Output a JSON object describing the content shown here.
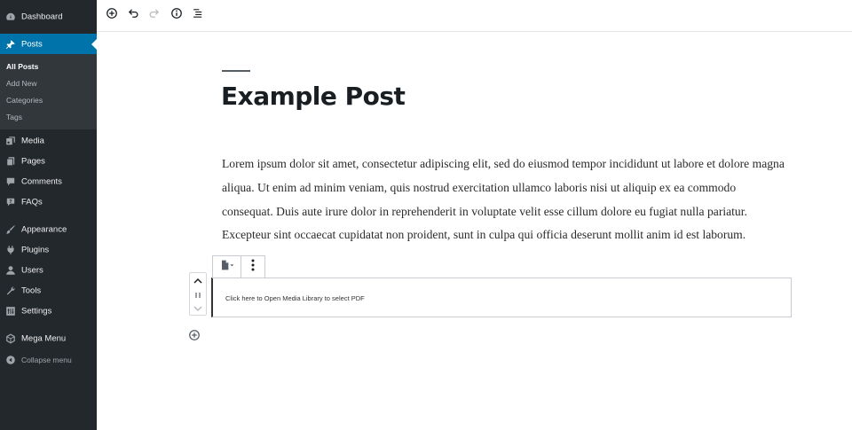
{
  "sidebar": {
    "menu_top": [
      {
        "label": "Dashboard",
        "icon": "dashboard-icon"
      },
      {
        "label": "Posts",
        "icon": "pin-icon",
        "active": true
      }
    ],
    "submenu": [
      {
        "label": "All Posts",
        "current": true
      },
      {
        "label": "Add New"
      },
      {
        "label": "Categories"
      },
      {
        "label": "Tags"
      }
    ],
    "menu_bottom": [
      {
        "label": "Media",
        "icon": "media-icon"
      },
      {
        "label": "Pages",
        "icon": "pages-icon"
      },
      {
        "label": "Comments",
        "icon": "comments-icon"
      },
      {
        "label": "FAQs",
        "icon": "help-icon"
      },
      {
        "label": "Appearance",
        "icon": "brush-icon"
      },
      {
        "label": "Plugins",
        "icon": "plugin-icon"
      },
      {
        "label": "Users",
        "icon": "users-icon"
      },
      {
        "label": "Tools",
        "icon": "wrench-icon"
      },
      {
        "label": "Settings",
        "icon": "settings-icon"
      },
      {
        "label": "Mega Menu",
        "icon": "mega-menu-icon"
      },
      {
        "label": "Collapse menu",
        "icon": "collapse-icon"
      }
    ]
  },
  "toolbar": {
    "buttons": [
      "add-block-icon",
      "undo-icon",
      "redo-icon",
      "info-icon",
      "outline-icon"
    ]
  },
  "post": {
    "title": "Example Post",
    "body": " Lorem ipsum dolor sit amet, consectetur adipiscing elit, sed do eiusmod tempor incididunt ut labore et dolore magna aliqua. Ut enim ad minim veniam, quis nostrud exercitation ullamco laboris nisi ut aliquip ex ea commodo consequat. Duis aute irure dolor in reprehenderit in voluptate velit esse cillum dolore eu fugiat nulla pariatur. Excepteur sint occaecat cupidatat non proident, sunt in culpa qui officia deserunt mollit anim id est laborum."
  },
  "pdf_block": {
    "text": "Click here to Open Media Library to select PDF"
  },
  "colors": {
    "sidebar_bg": "#23282d",
    "submenu_bg": "#32373c",
    "accent": "#0073aa"
  }
}
